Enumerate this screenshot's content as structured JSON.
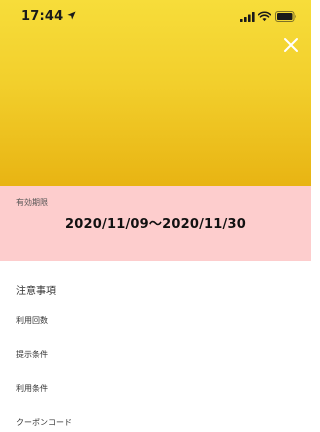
{
  "status_bar": {
    "time": "17:44",
    "icons": [
      "location-arrow-icon",
      "signal-bars-icon",
      "wifi-icon",
      "battery-icon"
    ]
  },
  "header": {
    "close_icon": "close-icon",
    "gradient_colors": [
      "#f7dd3a",
      "#e8b413"
    ]
  },
  "validity": {
    "label": "有効期限",
    "dates": "2020/11/09〜2020/11/30",
    "background": "#fdcdcd"
  },
  "notes": {
    "heading": "注意事項",
    "items": [
      {
        "label": "利用回数"
      },
      {
        "label": "提示条件"
      },
      {
        "label": "利用条件"
      },
      {
        "label": "クーポンコード"
      }
    ]
  }
}
